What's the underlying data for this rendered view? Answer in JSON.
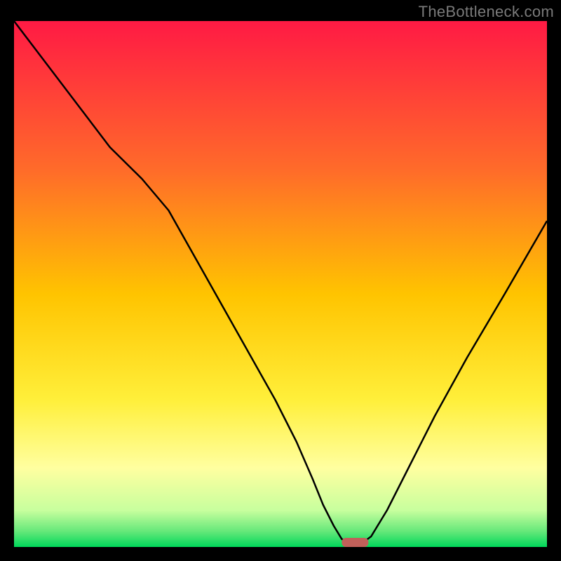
{
  "attribution": "TheBottleneck.com",
  "colors": {
    "background_black": "#000000",
    "gradient_top": "#ff1a44",
    "gradient_mid_upper": "#ff7a2a",
    "gradient_mid": "#ffd400",
    "gradient_lower": "#ffff66",
    "gradient_pale": "#ffffcc",
    "gradient_bottom": "#00e05a",
    "curve": "#000000",
    "marker": "#c1605a"
  },
  "chart_data": {
    "type": "line",
    "title": "",
    "xlabel": "",
    "ylabel": "",
    "x_range": [
      0,
      100
    ],
    "y_range": [
      0,
      100
    ],
    "ylim": [
      0,
      100
    ],
    "series": [
      {
        "name": "bottleneck-curve",
        "x": [
          0,
          6,
          12,
          18,
          24,
          29,
          34,
          39,
          44,
          49,
          53,
          56,
          58,
          60,
          61.5,
          63.5,
          65,
          67,
          70,
          74,
          79,
          85,
          92,
          100
        ],
        "y": [
          100,
          92,
          84,
          76,
          70,
          64,
          55,
          46,
          37,
          28,
          20,
          13,
          8,
          4,
          1.5,
          0.5,
          0.5,
          2,
          7,
          15,
          25,
          36,
          48,
          62
        ]
      }
    ],
    "marker": {
      "x": 64,
      "y": 0,
      "width_pct": 5,
      "color": "#c1605a"
    },
    "gradient_stops_pct": [
      {
        "offset": 0,
        "color": "#ff1a44"
      },
      {
        "offset": 28,
        "color": "#ff6a2a"
      },
      {
        "offset": 52,
        "color": "#ffc400"
      },
      {
        "offset": 72,
        "color": "#ffef3a"
      },
      {
        "offset": 85,
        "color": "#ffffa0"
      },
      {
        "offset": 93,
        "color": "#c8ff9e"
      },
      {
        "offset": 97,
        "color": "#66e87a"
      },
      {
        "offset": 100,
        "color": "#00d85a"
      }
    ]
  }
}
